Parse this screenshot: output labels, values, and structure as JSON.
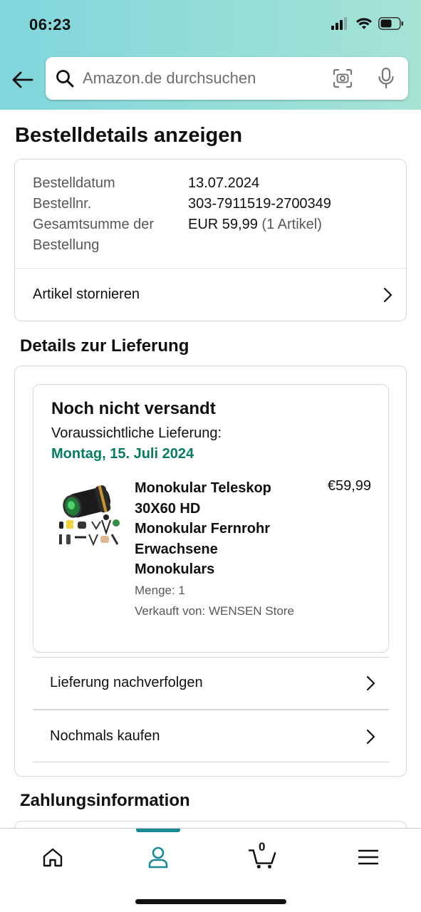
{
  "status_bar": {
    "time": "06:23"
  },
  "search": {
    "placeholder": "Amazon.de durchsuchen"
  },
  "page": {
    "title": "Bestelldetails anzeigen"
  },
  "order_summary": {
    "date_label": "Bestelldatum",
    "date_value": "13.07.2024",
    "number_label": "Bestellnr.",
    "number_value": "303-7911519-2700349",
    "total_label_line1": "Gesamtsumme der",
    "total_label_line2": "Bestellung",
    "total_value": "EUR 59,99",
    "total_items": "(1 Artikel)",
    "cancel_label": "Artikel stornieren"
  },
  "delivery": {
    "section_title": "Details zur Lieferung",
    "status": "Noch nicht versandt",
    "estimate_label": "Voraussichtliche Lieferung:",
    "estimate_date": "Montag, 15. Juli 2024",
    "estimate_color": "#067d62",
    "product": {
      "title_lines": [
        "Monokular Teleskop",
        "30X60 HD",
        "Monokular Fernrohr",
        "Erwachsene",
        "Monokulars"
      ],
      "price": "€59,99",
      "quantity": "Menge: 1",
      "seller": "Verkauft von: WENSEN Store",
      "image_icon": "monocular-product-image"
    },
    "track_label": "Lieferung nachverfolgen",
    "buy_again_label": "Nochmals kaufen"
  },
  "payment": {
    "section_title": "Zahlungsinformation"
  },
  "bottom_nav": {
    "items": [
      "home-icon",
      "account-icon",
      "cart-icon",
      "menu-icon"
    ],
    "cart_count": "0",
    "active": "account-icon",
    "accent": "#1a8a97"
  }
}
